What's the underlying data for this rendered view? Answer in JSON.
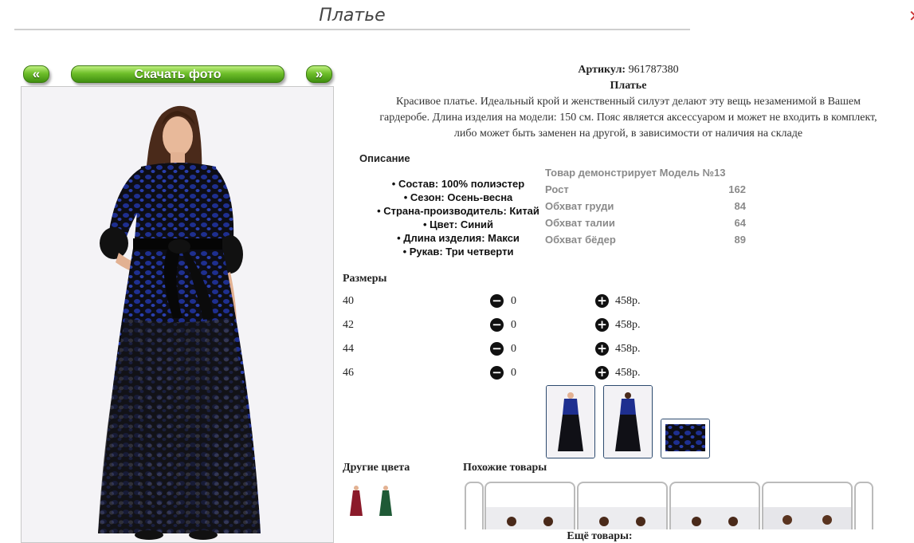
{
  "page": {
    "title": "Платье"
  },
  "gallery": {
    "prev_label": "«",
    "download_label": "Скачать фото",
    "next_label": "»"
  },
  "product": {
    "article_label": "Артикул:",
    "article_value": "961787380",
    "name": "Платье",
    "description_lines": [
      "Красивое платье. Идеальный крой и женственный силуэт делают эту вещь незаменимой в Вашем",
      "гардеробе. Длина изделия на модели: 150 см. Пояс является аксессуаром и может не входить в комплект,",
      "либо может быть заменен на другой, в зависимости от наличия на складе"
    ],
    "props_title": "Описание",
    "props": [
      "• Состав: 100% полиэстер",
      "• Сезон: Осень-весна",
      "• Страна-производитель: Китай",
      "• Цвет: Синий",
      "• Длина изделия: Макси",
      "• Рукав: Три четверти"
    ]
  },
  "model": {
    "title": "Товар демонстрирует Модель №13",
    "rows": [
      {
        "label": "Рост",
        "value": "162"
      },
      {
        "label": "Обхват груди",
        "value": "84"
      },
      {
        "label": "Обхват талии",
        "value": "64"
      },
      {
        "label": "Обхват бёдер",
        "value": "89"
      }
    ]
  },
  "sizes": {
    "title": "Размеры",
    "rows": [
      {
        "size": "40",
        "qty": "0",
        "price": "458р."
      },
      {
        "size": "42",
        "qty": "0",
        "price": "458р."
      },
      {
        "size": "44",
        "qty": "0",
        "price": "458р."
      },
      {
        "size": "46",
        "qty": "0",
        "price": "458р."
      }
    ],
    "minus_icon": "minus-circle-icon",
    "plus_icon": "plus-circle-icon"
  },
  "other_colors": {
    "title": "Другие цвета",
    "swatches": [
      "#8b1a2a",
      "#1f5a36"
    ]
  },
  "similar": {
    "title": "Похожие товары"
  },
  "more": {
    "label": "Ещё товары:"
  },
  "colors": {
    "accent_green": "#6fbf2a",
    "dress_blue": "#1e2f8f",
    "thumb_border": "#2c4a6e"
  }
}
